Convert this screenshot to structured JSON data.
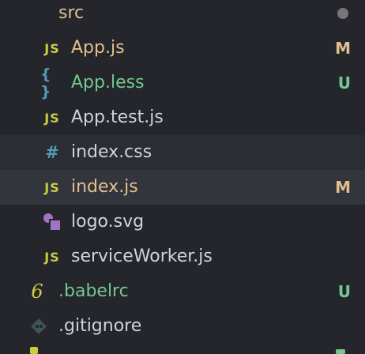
{
  "colors": {
    "background": "#24262b",
    "modified": "#e2c08d",
    "untracked": "#73c991",
    "default_text": "#cfd3dc",
    "js_icon": "#cbcb41",
    "less_icon": "#519aba",
    "css_icon": "#519aba",
    "svg_icon": "#a074c4",
    "babel_icon": "#cbcb41",
    "git_icon": "#41535b",
    "folder_dot": "#77777a"
  },
  "folder": {
    "label": "src",
    "badge": "●"
  },
  "files": [
    {
      "label": "App.js",
      "icon": "js-icon",
      "icon_text": "JS",
      "badge": "M",
      "status": "modified"
    },
    {
      "label": "App.less",
      "icon": "less-icon",
      "icon_text": "{ }",
      "badge": "U",
      "status": "untracked"
    },
    {
      "label": "App.test.js",
      "icon": "js-icon",
      "icon_text": "JS",
      "badge": "",
      "status": "none"
    },
    {
      "label": "index.css",
      "icon": "css-icon",
      "icon_text": "#",
      "badge": "",
      "status": "none"
    },
    {
      "label": "index.js",
      "icon": "js-icon",
      "icon_text": "JS",
      "badge": "M",
      "status": "modified"
    },
    {
      "label": "logo.svg",
      "icon": "svg-icon",
      "icon_text": "",
      "badge": "",
      "status": "none"
    },
    {
      "label": "serviceWorker.js",
      "icon": "js-icon",
      "icon_text": "JS",
      "badge": "",
      "status": "none"
    }
  ],
  "root_files": [
    {
      "label": ".babelrc",
      "icon": "babel-icon",
      "icon_text": "6",
      "badge": "U",
      "status": "untracked"
    },
    {
      "label": ".gitignore",
      "icon": "git-icon",
      "icon_text": "",
      "badge": "",
      "status": "none"
    }
  ]
}
